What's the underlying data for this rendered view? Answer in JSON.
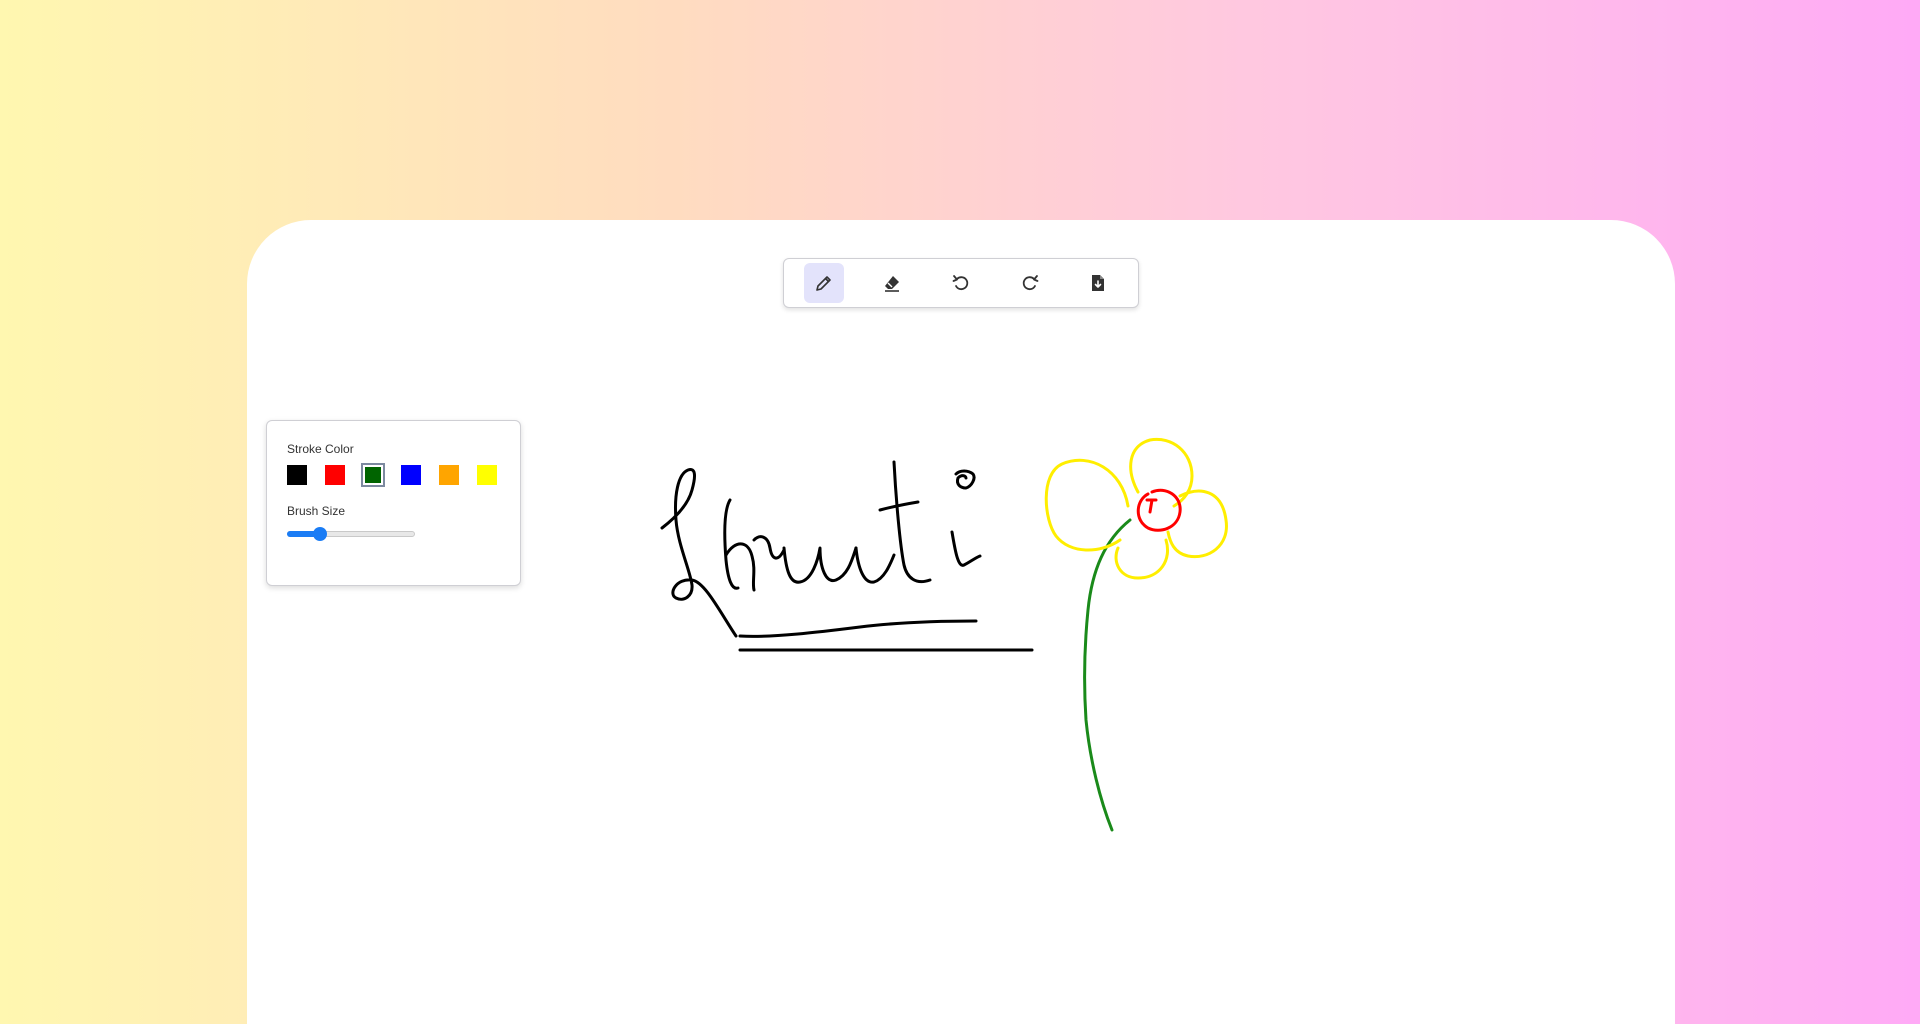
{
  "toolbar": {
    "tools": [
      {
        "name": "pencil-icon",
        "active": true
      },
      {
        "name": "eraser-icon",
        "active": false
      },
      {
        "name": "undo-icon",
        "active": false
      },
      {
        "name": "redo-icon",
        "active": false
      },
      {
        "name": "download-file-icon",
        "active": false
      }
    ]
  },
  "panel": {
    "stroke_color_label": "Stroke Color",
    "brush_size_label": "Brush Size",
    "colors": [
      "#000000",
      "#ff0000",
      "#006400",
      "#0000ff",
      "#ffa500",
      "#ffff00"
    ],
    "selected_color": "#006400",
    "brush_size_fraction": 0.26
  },
  "colors": {
    "accent": "#1a7cf5",
    "background_gradient_left": "#fff7b0",
    "background_gradient_right": "#ffaaf6",
    "canvas": "#ffffff"
  }
}
